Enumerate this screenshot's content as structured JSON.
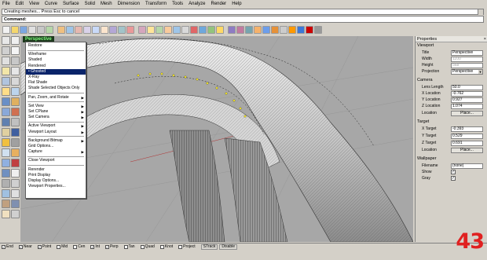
{
  "menu": [
    "File",
    "Edit",
    "View",
    "Curve",
    "Surface",
    "Solid",
    "Mesh",
    "Dimension",
    "Transform",
    "Tools",
    "Analyze",
    "Render",
    "Help"
  ],
  "command": {
    "history": "Creating meshes... Press Esc to cancel",
    "prompt": "Command:"
  },
  "viewport": {
    "title": "Perspective"
  },
  "context_menu": {
    "items": [
      {
        "label": "Restore",
        "arrow": ""
      },
      {
        "label": "Wireframe",
        "arrow": ""
      },
      {
        "label": "Shaded",
        "arrow": ""
      },
      {
        "label": "Rendered",
        "arrow": ""
      },
      {
        "label": "• Ghosted",
        "arrow": "",
        "selected": true
      },
      {
        "label": "X-Ray",
        "arrow": ""
      },
      {
        "label": "Flat Shade",
        "arrow": ""
      },
      {
        "label": "Shade Selected Objects Only",
        "arrow": ""
      },
      {
        "label": "Pan, Zoom, and Rotate",
        "arrow": "▶"
      },
      {
        "label": "Set View",
        "arrow": "▶"
      },
      {
        "label": "Set CPlane",
        "arrow": "▶"
      },
      {
        "label": "Set Camera",
        "arrow": "▶"
      },
      {
        "label": "Active Viewport",
        "arrow": "▶"
      },
      {
        "label": "Viewport Layout",
        "arrow": "▶"
      },
      {
        "label": "Background Bitmap",
        "arrow": "▶"
      },
      {
        "label": "Grid Options...",
        "arrow": ""
      },
      {
        "label": "Capture",
        "arrow": "▶"
      },
      {
        "label": "Close Viewport",
        "arrow": ""
      },
      {
        "label": "Rerender",
        "arrow": ""
      },
      {
        "label": "Print Display",
        "arrow": ""
      },
      {
        "label": "Display Options...",
        "arrow": ""
      },
      {
        "label": "Viewport Properties...",
        "arrow": ""
      }
    ]
  },
  "properties": {
    "title": "Properties",
    "close": "×",
    "sections": {
      "viewport": "Viewport",
      "camera": "Camera",
      "target": "Target",
      "wallpaper": "Wallpaper"
    },
    "fields": {
      "title_label": "Title",
      "title_value": "Perspective",
      "width_label": "Width",
      "width_value": "1100",
      "height_label": "Height",
      "height_value": "568",
      "projection_label": "Projection",
      "projection_value": "Perspective",
      "lens_label": "Lens Length",
      "lens_value": "50.0",
      "xloc_label": "X Location",
      "xloc_value": "-0.762",
      "yloc_label": "Y Location",
      "yloc_value": "0.927",
      "zloc_label": "Z Location",
      "zloc_value": "1.074",
      "loc_label": "Location",
      "loc_button": "Place...",
      "xt_label": "X Target",
      "xt_value": "-0.393",
      "yt_label": "Y Target",
      "yt_value": "0.529",
      "zt_label": "Z Target",
      "zt_value": "0.691",
      "tloc_label": "Location",
      "tloc_button": "Place...",
      "filename_label": "Filename",
      "filename_value": "(none)",
      "show_label": "Show",
      "show_checked": "✓",
      "gray_label": "Gray",
      "gray_checked": "✓"
    }
  },
  "osnaps": [
    {
      "label": "End",
      "checked": "✓"
    },
    {
      "label": "Near",
      "checked": "✓"
    },
    {
      "label": "Point",
      "checked": "✓"
    },
    {
      "label": "Mid",
      "checked": ""
    },
    {
      "label": "Cen",
      "checked": ""
    },
    {
      "label": "Int",
      "checked": "✓"
    },
    {
      "label": "Perp",
      "checked": "✓"
    },
    {
      "label": "Tan",
      "checked": ""
    },
    {
      "label": "Quad",
      "checked": ""
    },
    {
      "label": "Knot",
      "checked": ""
    },
    {
      "label": "Project",
      "checked": ""
    }
  ],
  "snap_buttons": [
    "STrack",
    "Disable"
  ],
  "page_number": "43",
  "colors": {
    "viewport_bg": "#a7a7a7",
    "label_bg": "#1f3a1f",
    "label_fg": "#7cff7c",
    "selected_bg": "#0a246a",
    "page_number": "#e02020"
  }
}
